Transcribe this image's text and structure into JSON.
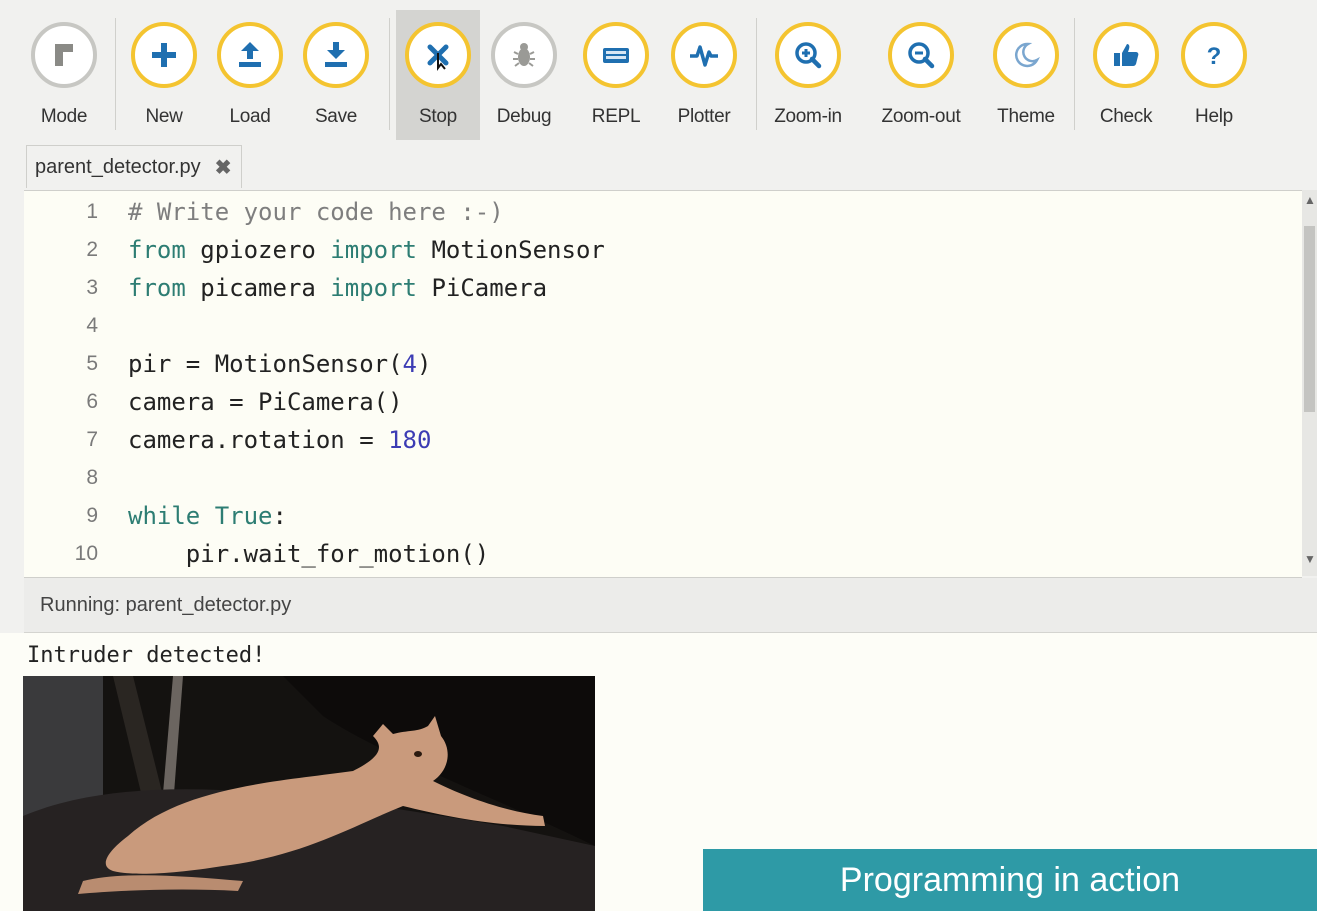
{
  "toolbar": {
    "buttons": [
      {
        "label": "Mode",
        "icon": "mode-icon"
      },
      {
        "label": "New",
        "icon": "plus-icon"
      },
      {
        "label": "Load",
        "icon": "upload-icon"
      },
      {
        "label": "Save",
        "icon": "download-icon"
      },
      {
        "label": "Stop",
        "icon": "stop-icon"
      },
      {
        "label": "Debug",
        "icon": "bug-icon"
      },
      {
        "label": "REPL",
        "icon": "keyboard-icon"
      },
      {
        "label": "Plotter",
        "icon": "pulse-icon"
      },
      {
        "label": "Zoom-in",
        "icon": "zoom-in-icon"
      },
      {
        "label": "Zoom-out",
        "icon": "zoom-out-icon"
      },
      {
        "label": "Theme",
        "icon": "moon-icon"
      },
      {
        "label": "Check",
        "icon": "thumbs-up-icon"
      },
      {
        "label": "Help",
        "icon": "question-icon"
      }
    ]
  },
  "tab": {
    "filename": "parent_detector.py",
    "close_glyph": "✖"
  },
  "editor": {
    "lines": [
      {
        "num": "1",
        "code": "# Write your code here :-)"
      },
      {
        "num": "2",
        "code": "from gpiozero import MotionSensor"
      },
      {
        "num": "3",
        "code": "from picamera import PiCamera"
      },
      {
        "num": "4",
        "code": ""
      },
      {
        "num": "5",
        "code": "pir = MotionSensor(4)"
      },
      {
        "num": "6",
        "code": "camera = PiCamera()"
      },
      {
        "num": "7",
        "code": "camera.rotation = 180"
      },
      {
        "num": "8",
        "code": ""
      },
      {
        "num": "9",
        "code": "while True:"
      },
      {
        "num": "10",
        "code": "    pir.wait_for_motion()"
      }
    ]
  },
  "runner": {
    "title": "Running: parent_detector.py",
    "output": "Intruder detected!"
  },
  "caption": "Programming in action",
  "colors": {
    "accent": "#f4c430",
    "caption_bg": "#2e9aa6",
    "keyword": "#2d7d73"
  }
}
